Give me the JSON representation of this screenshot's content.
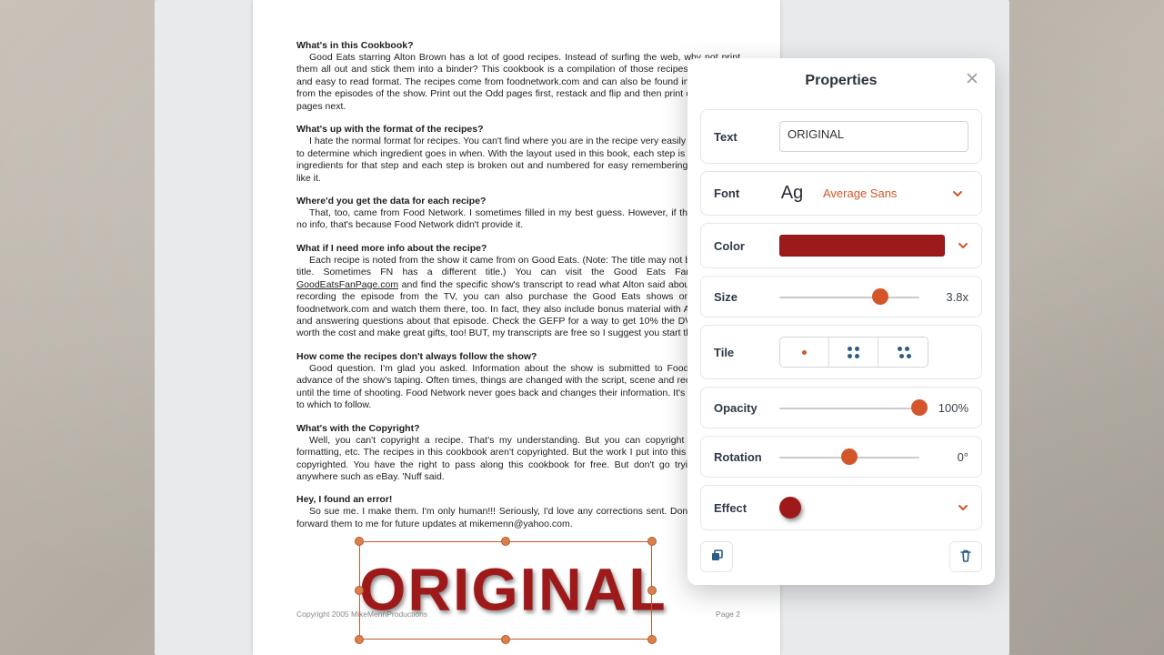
{
  "doc": {
    "sec1_title": "What's in this Cookbook?",
    "sec1_body": "Good Eats starring Alton Brown has a lot of good recipes. Instead of surfing the web, why not print them all out and stick them into a binder? This cookbook is a compilation of those recipes in a unique and easy to read format. The recipes come from foodnetwork.com and can also be found in verbal form from the episodes of the show. Print out the Odd pages first, restack and flip and then print out the Even pages next.",
    "sec2_title": "What's up with the format of the recipes?",
    "sec2_body": "I hate the normal format for recipes. You can't find where you are in the recipe very easily and it's hard to determine which ingredient goes in when. With the layout used in this book, each step is linked to the ingredients for that step and each step is broken out and numbered for easy remembering. I hope you like it.",
    "sec3_title": "Where'd you get the data for each recipe?",
    "sec3_body": "That, too, came from Food Network. I sometimes filled in my best guess. However, if there's little or no info, that's because Food Network didn't provide it.",
    "sec4_title": "What if I need more info about the recipe?",
    "sec4_body_a": "Each recipe is noted from the show it came from on Good Eats. (Note: The title may not be the actual title. Sometimes FN has a different title.) You can visit the Good Eats Fan Page at ",
    "sec4_link": "GoodEatsFanPage.com",
    "sec4_body_b": " and find the specific show's transcript to read what Alton said about it. Short of recording the episode from the TV, you can also purchase the Good Eats shows on DVD from foodnetwork.com and watch them there, too. In fact, they also include bonus material with Alton reading and answering questions about that episode. Check the GEFP for a way to get 10% the DVDs. They're worth the cost and make great gifts, too! BUT, my transcripts are free so I suggest you start there first.",
    "sec5_title": "How come the recipes don't always follow the show?",
    "sec5_body": "Good question. I'm glad you asked. Information about the show is submitted to Food Network in advance of the show's taping. Often times, things are changed with the script, scene and recipe even up until the time of shooting. Food Network never goes back and changes their information. It's up to you as to which to follow.",
    "sec6_title": "What's with the Copyright?",
    "sec6_body": "Well, you can't copyright a recipe. That's my understanding. But you can copyright the style of formatting, etc. The recipes in this cookbook aren't copyrighted. But the work I put into this cookbook is copyrighted. You have the right to pass along this cookbook for free. But don't go trying to sell it anywhere such as eBay. 'Nuff said.",
    "sec7_title": "Hey, I found an error!",
    "sec7_body": "So sue me. I make them. I'm only human!!! Seriously, I'd love any corrections sent. Don't hesitate to forward them to me for future updates at mikemenn@yahoo.com.",
    "footer_left": "Copyright 2005 MikeMennProductions",
    "footer_right": "Page 2"
  },
  "watermark_text": "ORIGINAL",
  "panel": {
    "title": "Properties",
    "labels": {
      "text": "Text",
      "font": "Font",
      "color": "Color",
      "size": "Size",
      "tile": "Tile",
      "opacity": "Opacity",
      "rotation": "Rotation",
      "effect": "Effect"
    },
    "text_value": "ORIGINAL",
    "font_sample": "Ag",
    "font_name": "Average Sans",
    "color_hex": "#9e1a1a",
    "size_value": "3.8x",
    "size_pct": 72,
    "opacity_value": "100%",
    "opacity_pct": 100,
    "rotation_value": "0°",
    "rotation_pct": 50,
    "accent": "#d2562a",
    "effect_color": "#9e1a1a"
  }
}
